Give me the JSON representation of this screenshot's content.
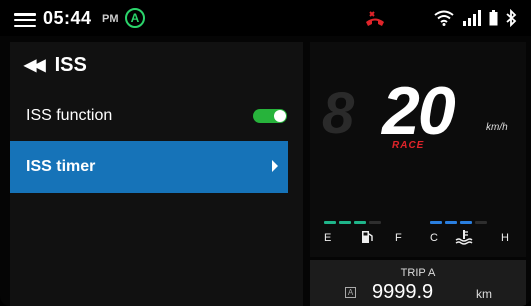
{
  "status_bar": {
    "time": "05:44",
    "ampm": "PM",
    "auto_badge": "A",
    "icons": [
      "menu-icon",
      "phone-missed-icon",
      "wifi-icon",
      "signal-icon",
      "battery-icon",
      "bluetooth-icon"
    ]
  },
  "menu": {
    "title": "ISS",
    "items": [
      {
        "label": "ISS function",
        "control": "toggle",
        "enabled": true
      },
      {
        "label": "ISS timer",
        "control": "arrow",
        "selected": true
      }
    ]
  },
  "dashboard": {
    "speed": "20",
    "speed_unit": "km/h",
    "mode": "RACE",
    "fuel": {
      "empty_label": "E",
      "full_label": "F",
      "level_segments": 3,
      "total_segments": 4
    },
    "temperature": {
      "cold_label": "C",
      "hot_label": "H",
      "level_segments": 3,
      "total_segments": 4
    }
  },
  "trip": {
    "title": "TRIP A",
    "badge": "A",
    "value": "9999.9",
    "unit": "km"
  },
  "colors": {
    "accent_blue": "#1673b8",
    "toggle_green": "#27b33b",
    "auto_green": "#2bd46b",
    "race_red": "#e0242a",
    "fuel_bar": "#1fb58a",
    "temp_bar": "#2a7fe0",
    "phone_red": "#e0242a"
  }
}
